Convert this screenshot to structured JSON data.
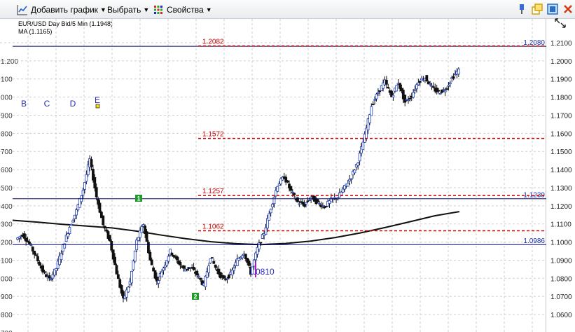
{
  "toolbar": {
    "add_chart": "Добавить график",
    "select": "Выбрать",
    "properties": "Свойства"
  },
  "chart_info": {
    "symbol": "EUR/USD Day Bid/5 Min (1.1948)",
    "ma": "MA (1.1165)"
  },
  "icons": [
    "line-chart-icon",
    "select-arrow-icon",
    "grid-properties-icon",
    "pin-icon",
    "window-restore-icon",
    "window-maximize-icon",
    "close-icon",
    "expand-icon"
  ],
  "colors": {
    "fib_red": "#cc0000",
    "hline_navy": "#000066",
    "candle_blue": "#1f3fbf",
    "grid": "#cfcfcf",
    "ma": "#111111"
  },
  "chart_data": {
    "type": "candlestick",
    "y_range": [
      1.055,
      1.217
    ],
    "y_ticks": [
      "1.2100",
      "1.2000",
      "1.1900",
      "1.1800",
      "1.1700",
      "1.1600",
      "1.1500",
      "1.1400",
      "1.1300",
      "1.1200",
      "1.1100",
      "1.1000",
      "1.0900",
      "1.0800",
      "1.0700",
      "1.0600"
    ],
    "left_ticks": [
      "1.200",
      "100",
      "000",
      "900",
      "800",
      "700",
      "600",
      "500",
      "400",
      "300",
      "200",
      "100",
      "000",
      "900",
      "800",
      "700"
    ],
    "grid": true,
    "levels": [
      {
        "value": 1.2082,
        "label": "1.2082",
        "style": "dashed-red"
      },
      {
        "value": 1.1572,
        "label": "1.1572",
        "style": "dashed-red"
      },
      {
        "value": 1.1257,
        "label": "1.1257",
        "style": "dashed-red"
      },
      {
        "value": 1.1062,
        "label": "1.1062",
        "style": "dashed-red"
      }
    ],
    "hlines": [
      {
        "value": 1.208,
        "label": "1.2080"
      },
      {
        "value": 1.1239,
        "label": "1.1239"
      },
      {
        "value": 1.0986,
        "label": "1.0986"
      }
    ],
    "wave_labels": [
      "B",
      "C",
      "D",
      "E"
    ],
    "markers": [
      "1",
      "2"
    ],
    "low_label": "1.0810",
    "close_points": [
      1.1015,
      1.1042,
      1.099,
      1.0918,
      1.0838,
      1.0792,
      1.0855,
      1.0975,
      1.1085,
      1.1172,
      1.129,
      1.1455,
      1.125,
      1.1095,
      1.1005,
      1.083,
      1.068,
      1.078,
      1.1005,
      1.11,
      1.09,
      1.078,
      1.086,
      1.095,
      1.0898,
      1.085,
      1.086,
      1.082,
      1.076,
      1.092,
      1.084,
      1.079,
      1.0822,
      1.09,
      1.0944,
      1.083,
      1.0964,
      1.1052,
      1.119,
      1.1316,
      1.136,
      1.128,
      1.122,
      1.1205,
      1.125,
      1.1215,
      1.1195,
      1.1232,
      1.1248,
      1.1302,
      1.1361,
      1.1448,
      1.1585,
      1.1752,
      1.1827,
      1.1886,
      1.1802,
      1.1882,
      1.1772,
      1.1808,
      1.1888,
      1.1908,
      1.1852,
      1.1826,
      1.1842,
      1.1905,
      1.1948
    ],
    "ma_points": [
      1.112,
      1.111,
      1.1098,
      1.1088,
      1.1078,
      1.106,
      1.1038,
      1.1018,
      1.1002,
      1.0991,
      1.0986,
      1.0992,
      1.1005,
      1.1025,
      1.105,
      1.108,
      1.1112,
      1.1145,
      1.1168
    ]
  }
}
